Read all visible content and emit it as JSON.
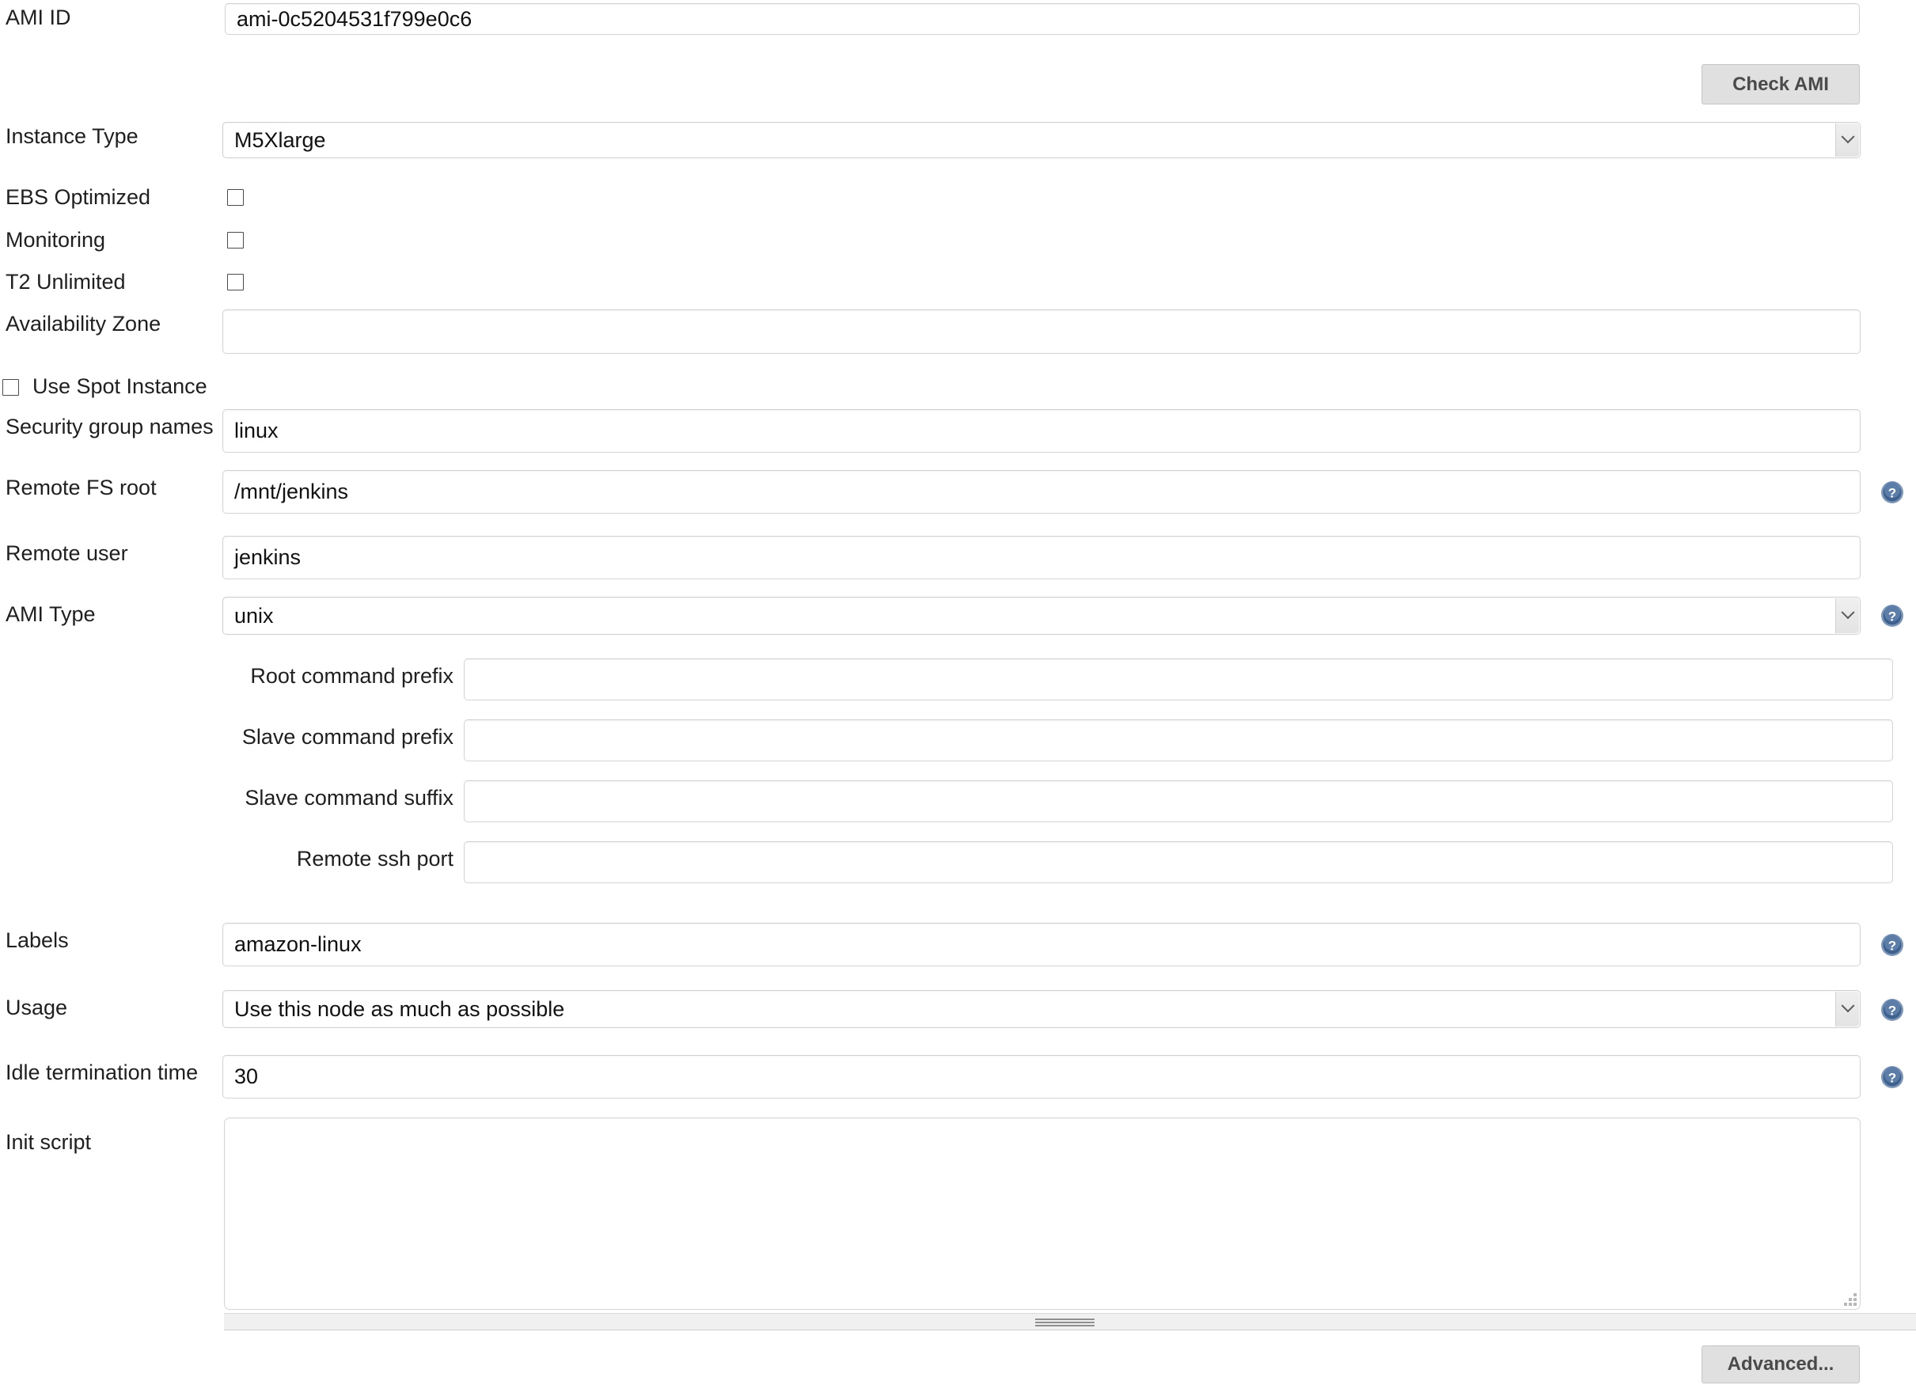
{
  "form": {
    "fields": {
      "ami_id": {
        "label": "AMI ID",
        "value": "ami-0c5204531f799e0c6"
      },
      "check_ami": {
        "label": "Check AMI"
      },
      "instance_type": {
        "label": "Instance Type",
        "value": "M5Xlarge"
      },
      "ebs_optimized": {
        "label": "EBS Optimized",
        "checked": false
      },
      "monitoring": {
        "label": "Monitoring",
        "checked": false
      },
      "t2_unlimited": {
        "label": "T2 Unlimited",
        "checked": false
      },
      "availability_zone": {
        "label": "Availability Zone",
        "value": ""
      },
      "use_spot_instance": {
        "label": "Use Spot Instance",
        "checked": false
      },
      "security_group_names": {
        "label": "Security group names",
        "value": "linux"
      },
      "remote_fs_root": {
        "label": "Remote FS root",
        "value": "/mnt/jenkins"
      },
      "remote_user": {
        "label": "Remote user",
        "value": "jenkins"
      },
      "ami_type": {
        "label": "AMI Type",
        "value": "unix"
      },
      "root_command_prefix": {
        "label": "Root command prefix",
        "value": ""
      },
      "slave_command_prefix": {
        "label": "Slave command prefix",
        "value": ""
      },
      "slave_command_suffix": {
        "label": "Slave command suffix",
        "value": ""
      },
      "remote_ssh_port": {
        "label": "Remote ssh port",
        "value": ""
      },
      "labels": {
        "label": "Labels",
        "value": "amazon-linux"
      },
      "usage": {
        "label": "Usage",
        "value": "Use this node as much as possible"
      },
      "idle_termination_time": {
        "label": "Idle termination time",
        "value": "30"
      },
      "init_script": {
        "label": "Init script",
        "value": ""
      },
      "advanced": {
        "label": "Advanced..."
      }
    },
    "icons": {
      "help": "help-icon",
      "chevron": "chevron-down-icon"
    },
    "colors": {
      "help_blue": "#4b6d9b",
      "button_bg": "#e0e0e0",
      "input_border": "#d4d4d4",
      "text": "#1f1f1f"
    }
  }
}
